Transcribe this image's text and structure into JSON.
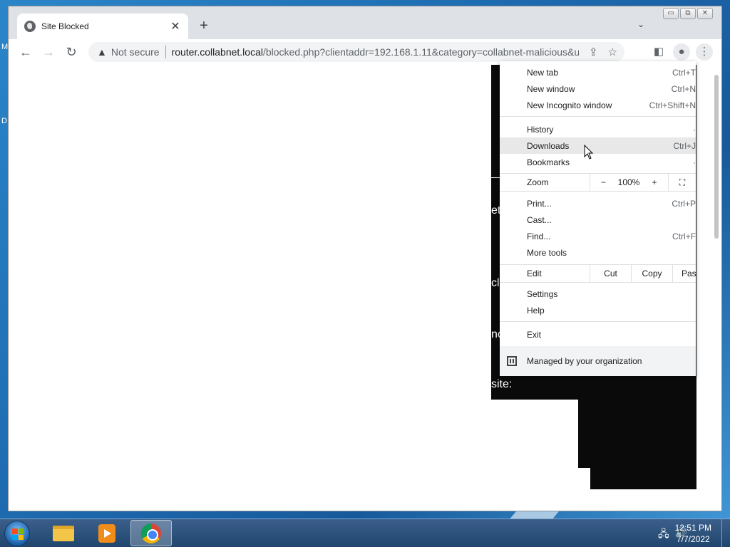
{
  "desktop": {
    "left_letters": [
      "M",
      "D"
    ]
  },
  "browser": {
    "tab": {
      "title": "Site Blocked"
    },
    "omnibox": {
      "security_label": "Not secure",
      "url_host": "router.collabnet.local",
      "url_rest": "/blocked.php?clientaddr=192.168.1.11&category=collabnet-malicious&u..."
    }
  },
  "page": {
    "fragments": [
      "et'",
      "cl",
      "nc",
      "site:"
    ]
  },
  "menu": {
    "items_group1": [
      {
        "label": "New tab",
        "shortcut": "Ctrl+T"
      },
      {
        "label": "New window",
        "shortcut": "Ctrl+N"
      },
      {
        "label": "New Incognito window",
        "shortcut": "Ctrl+Shift+N"
      }
    ],
    "items_group2": [
      {
        "label": "History",
        "shortcut": ""
      },
      {
        "label": "Downloads",
        "shortcut": "Ctrl+J"
      },
      {
        "label": "Bookmarks",
        "shortcut": ""
      }
    ],
    "zoom": {
      "label": "Zoom",
      "minus": "−",
      "value": "100%",
      "plus": "+"
    },
    "items_group3": [
      {
        "label": "Print...",
        "shortcut": "Ctrl+P"
      },
      {
        "label": "Cast...",
        "shortcut": ""
      },
      {
        "label": "Find...",
        "shortcut": "Ctrl+F"
      },
      {
        "label": "More tools",
        "shortcut": ""
      }
    ],
    "edit": {
      "label": "Edit",
      "cut": "Cut",
      "copy": "Copy",
      "paste": "Pas"
    },
    "items_group4": [
      {
        "label": "Settings"
      },
      {
        "label": "Help"
      }
    ],
    "exit": "Exit",
    "managed": "Managed by your organization",
    "hovered_item": "Downloads"
  },
  "taskbar": {
    "clock_time": "12:51 PM",
    "clock_date": "7/7/2022"
  }
}
